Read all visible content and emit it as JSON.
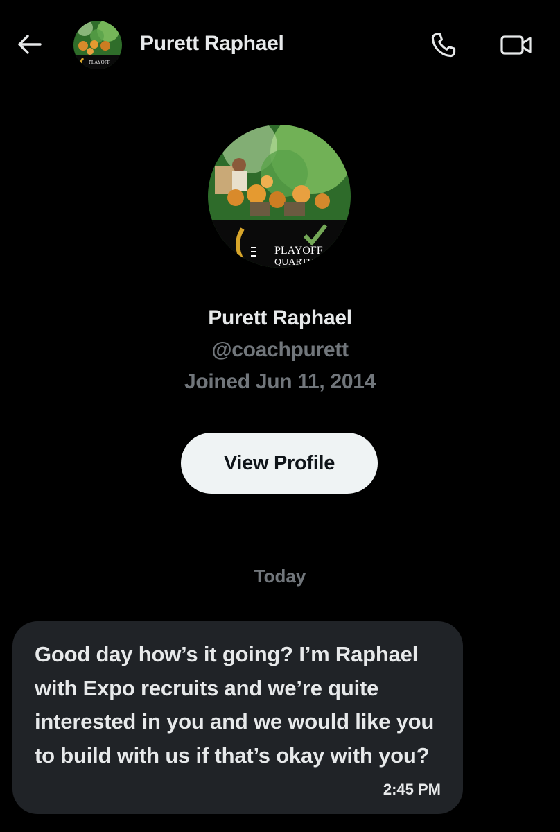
{
  "header": {
    "contact_name": "Purett Raphael",
    "back_icon": "arrow-left-icon",
    "call_icon": "phone-icon",
    "video_icon": "video-camera-icon",
    "avatar_text": "PLAYOFF"
  },
  "profile": {
    "name": "Purett Raphael",
    "handle": "@coachpurett",
    "joined": "Joined Jun 11, 2014",
    "view_profile_label": "View Profile",
    "avatar_text_line1": "PLAYOFF",
    "avatar_text_line2": "QUARTE"
  },
  "conversation": {
    "date_divider": "Today",
    "messages": [
      {
        "text": "Good day how’s it going? I’m Raphael with Expo recruits and we’re quite interested in you and we would like you to build with us if that’s okay with you?",
        "time": "2:45 PM"
      }
    ]
  },
  "colors": {
    "background": "#000000",
    "text_primary": "#e7e9ea",
    "text_secondary": "#71767b",
    "bubble": "#202327",
    "button_bg": "#eff3f4",
    "button_text": "#0f1419"
  }
}
